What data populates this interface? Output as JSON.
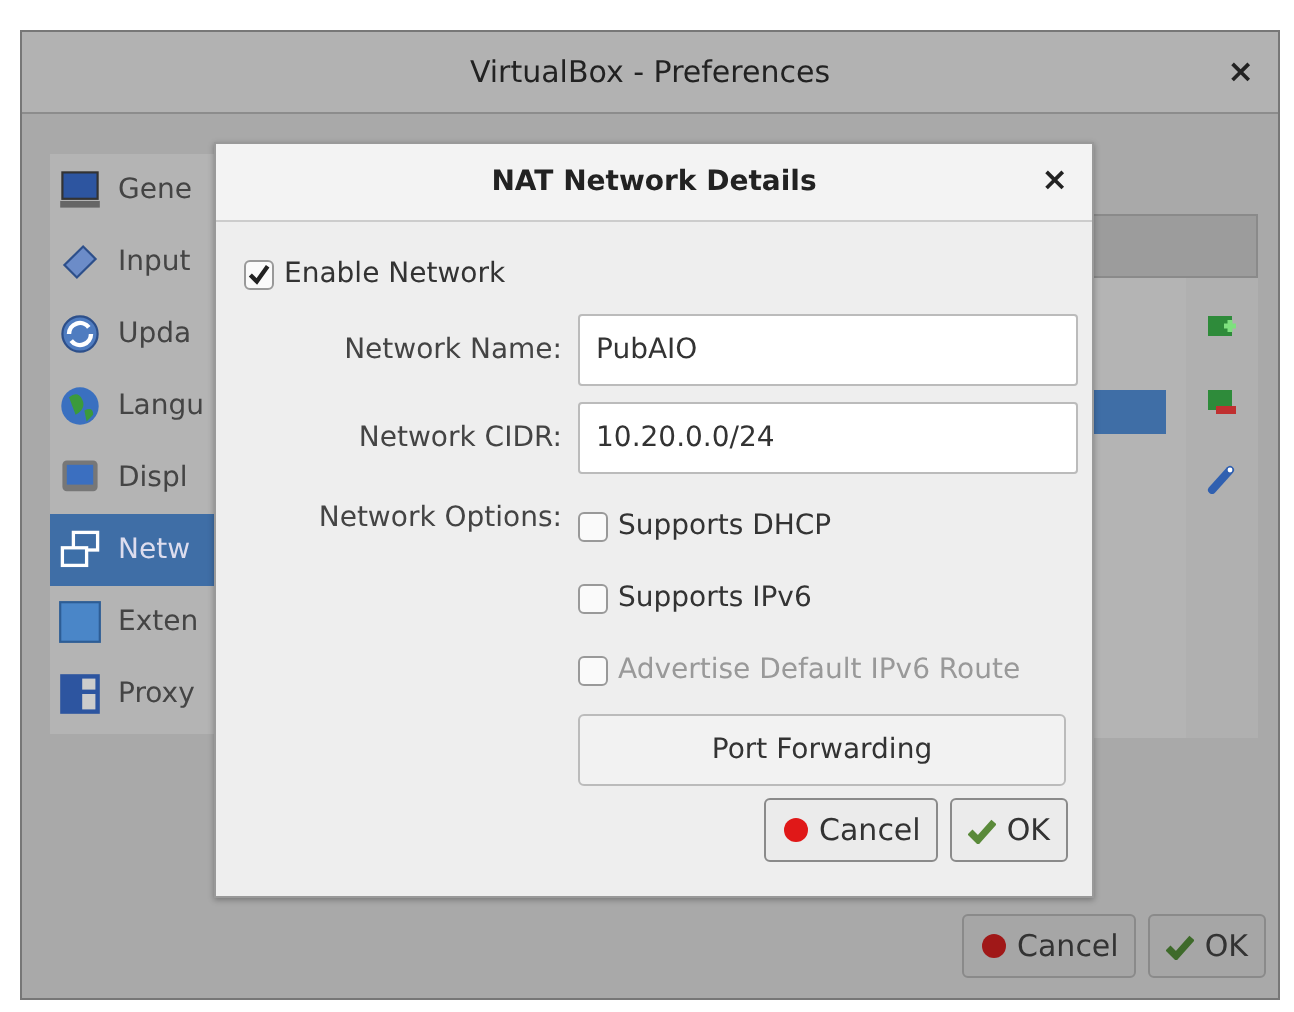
{
  "window": {
    "title": "VirtualBox - Preferences",
    "close": "×"
  },
  "sidebar": {
    "items": [
      {
        "label": "Gene",
        "kind": "monitor",
        "selected": false
      },
      {
        "label": "Input",
        "kind": "key",
        "selected": false
      },
      {
        "label": "Upda",
        "kind": "sync",
        "selected": false
      },
      {
        "label": "Langu",
        "kind": "globe",
        "selected": false
      },
      {
        "label": "Displ",
        "kind": "screen",
        "selected": false
      },
      {
        "label": "Netw",
        "kind": "network",
        "selected": true
      },
      {
        "label": "Exten",
        "kind": "square",
        "selected": false
      },
      {
        "label": "Proxy",
        "kind": "panels",
        "selected": false
      }
    ]
  },
  "tools": [
    {
      "kind": "add"
    },
    {
      "kind": "remove"
    },
    {
      "kind": "edit"
    }
  ],
  "buttons": [
    {
      "label": "Cancel",
      "kind": "cancel"
    },
    {
      "label": "OK",
      "kind": "ok"
    }
  ],
  "dialog": {
    "title": "NAT Network Details",
    "close": "×",
    "enable": {
      "label": "Enable Network",
      "checked": true
    },
    "fields": [
      {
        "label": "Network Name:",
        "value": "PubAIO"
      },
      {
        "label": "Network CIDR:",
        "value": "10.20.0.0/24"
      }
    ],
    "options_label": "Network Options:",
    "options": [
      {
        "label": "Supports DHCP",
        "checked": false,
        "disabled": false
      },
      {
        "label": "Supports IPv6",
        "checked": false,
        "disabled": false
      },
      {
        "label": "Advertise Default IPv6 Route",
        "checked": false,
        "disabled": true
      }
    ],
    "port_forwarding": "Port Forwarding",
    "buttons": [
      {
        "label": "Cancel",
        "kind": "cancel"
      },
      {
        "label": "OK",
        "kind": "ok"
      }
    ]
  }
}
